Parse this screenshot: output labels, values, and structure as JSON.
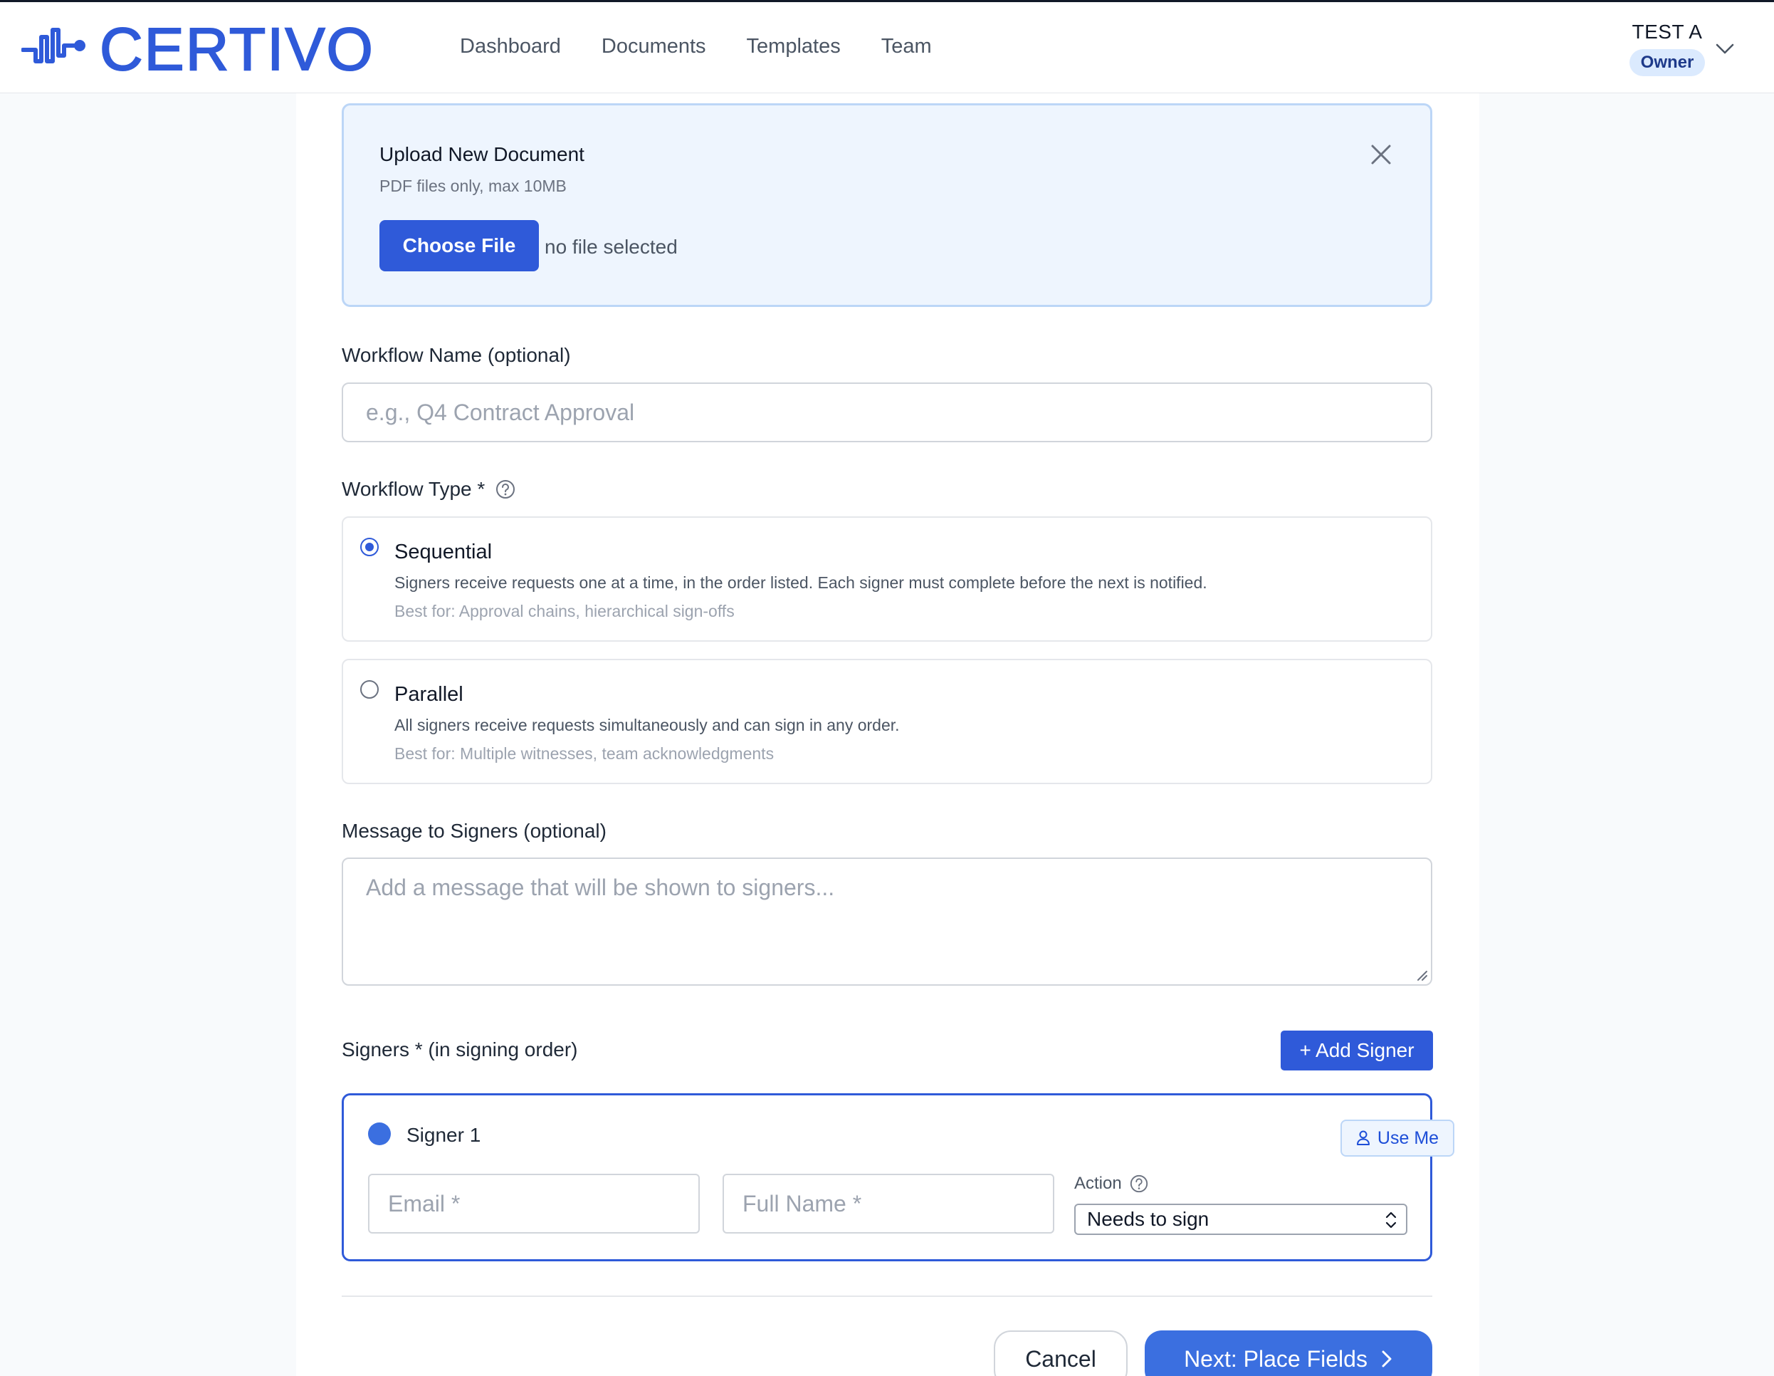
{
  "app": {
    "logo_text": "CERTIVO",
    "brand_color": "#2f5ad9"
  },
  "nav": {
    "items": [
      "Dashboard",
      "Documents",
      "Templates",
      "Team"
    ]
  },
  "user": {
    "name": "TEST A",
    "role": "Owner"
  },
  "upload": {
    "title": "Upload New Document",
    "subtitle": "PDF files only, max 10MB",
    "choose_label": "Choose File",
    "file_status": "no file selected"
  },
  "workflow_name": {
    "label": "Workflow Name (optional)",
    "placeholder": "e.g., Q4 Contract Approval"
  },
  "workflow_type": {
    "label": "Workflow Type *",
    "options": [
      {
        "title": "Sequential",
        "description": "Signers receive requests one at a time, in the order listed. Each signer must complete before the next is notified.",
        "best_for": "Best for: Approval chains, hierarchical sign-offs",
        "selected": true
      },
      {
        "title": "Parallel",
        "description": "All signers receive requests simultaneously and can sign in any order.",
        "best_for": "Best for: Multiple witnesses, team acknowledgments",
        "selected": false
      }
    ]
  },
  "message": {
    "label": "Message to Signers (optional)",
    "placeholder": "Add a message that will be shown to signers..."
  },
  "signers": {
    "label": "Signers * (in signing order)",
    "add_label": "+ Add Signer",
    "items": [
      {
        "title": "Signer 1",
        "use_me_label": "Use Me",
        "email_placeholder": "Email *",
        "name_placeholder": "Full Name *",
        "action_label": "Action",
        "action_value": "Needs to sign"
      }
    ]
  },
  "footer": {
    "cancel_label": "Cancel",
    "next_label": "Next: Place Fields"
  }
}
